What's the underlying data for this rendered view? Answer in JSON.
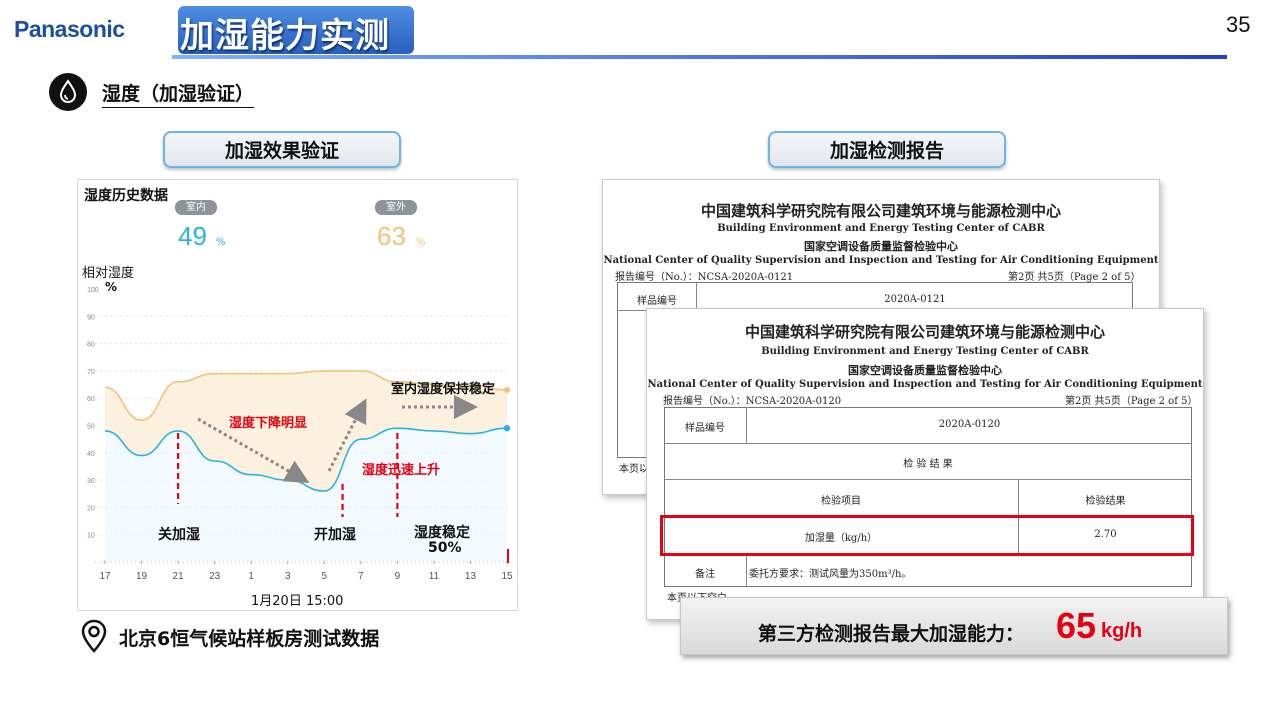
{
  "header": {
    "brand": "Panasonic",
    "title": "加湿能力实测",
    "page_number": "35"
  },
  "section": {
    "title": "湿度（加湿验证）",
    "icon": "water-drop-icon"
  },
  "left_panel": {
    "pill": "加湿效果验证",
    "chart_title": "湿度历史数据",
    "indoor_tag": "室内",
    "indoor_value": "49",
    "indoor_unit": "%",
    "outdoor_tag": "室外",
    "outdoor_value": "63",
    "outdoor_unit": "%",
    "ylabel": "相对湿度",
    "ylabel_unit": "%",
    "datetime": "1月20日 15:00",
    "notes": {
      "drop": "湿度下降明显",
      "rise": "湿度迅速上升",
      "stable_indoor": "室内湿度保持稳定",
      "off": "关加湿",
      "on": "开加湿",
      "stable": "湿度稳定",
      "stable_value": "50%"
    },
    "location": "北京6恒气候站样板房测试数据",
    "location_icon": "map-pin-icon"
  },
  "chart_data": {
    "type": "line",
    "title": "湿度历史数据",
    "ylabel": "相对湿度",
    "yunit": "%",
    "ylim": [
      0,
      100
    ],
    "yticks": [
      "100",
      "90",
      "80",
      "70",
      "60",
      "50",
      "40",
      "30",
      "20",
      "10"
    ],
    "x": [
      "17",
      "19",
      "21",
      "23",
      "1",
      "3",
      "5",
      "7",
      "9",
      "11",
      "13",
      "15"
    ],
    "series": [
      {
        "name": "室内",
        "color": "#2bb3e0",
        "values": [
          48,
          39,
          48,
          37,
          32,
          30,
          26,
          45,
          49,
          48,
          47,
          49
        ]
      },
      {
        "name": "室外",
        "color": "#f0c27a",
        "values": [
          64,
          52,
          66,
          69,
          69,
          69,
          70,
          70,
          66,
          65,
          65,
          63
        ]
      }
    ],
    "annotations": [
      {
        "text": "关加湿",
        "x": "21"
      },
      {
        "text": "开加湿",
        "x": "5"
      },
      {
        "text": "湿度稳定",
        "x": "9"
      }
    ]
  },
  "right_panel": {
    "pill": "加湿检测报告",
    "doc_back": {
      "org_cn": "中国建筑科学研究院有限公司建筑环境与能源检测中心",
      "org_en": "Building Environment and Energy Testing Center of CABR",
      "center_cn": "国家空调设备质量监督检验中心",
      "center_en": "National Center of Quality Supervision and Inspection and Testing for Air Conditioning Equipment",
      "report_no": "报告编号（No.）：NCSA-2020A-0121",
      "page": "第2页  共5页（Page 2 of 5）",
      "sample_label": "样品编号",
      "sample_value": "2020A-0121",
      "footer": "本页以"
    },
    "doc_front": {
      "org_cn": "中国建筑科学研究院有限公司建筑环境与能源检测中心",
      "org_en": "Building Environment and Energy Testing Center of CABR",
      "center_cn": "国家空调设备质量监督检验中心",
      "center_en": "National Center of Quality Supervision and Inspection and Testing for Air Conditioning Equipment",
      "report_no": "报告编号（No.）：NCSA-2020A-0120",
      "page": "第2页  共5页（Page 2 of 5）",
      "sample_label": "样品编号",
      "sample_value": "2020A-0120",
      "results_header": "检  验  结  果",
      "col_item": "检验项目",
      "col_result": "检验结果",
      "item": "加湿量（kg/h）",
      "result": "2.70",
      "remark_label": "备注",
      "remark": "委托方要求：测试风量为350m³/h。",
      "footer": "本页以下空白。"
    },
    "summary_label": "第三方检测报告最大加湿能力：",
    "summary_value": "65",
    "summary_unit": "kg/h",
    "accent_color": "#e60012"
  }
}
